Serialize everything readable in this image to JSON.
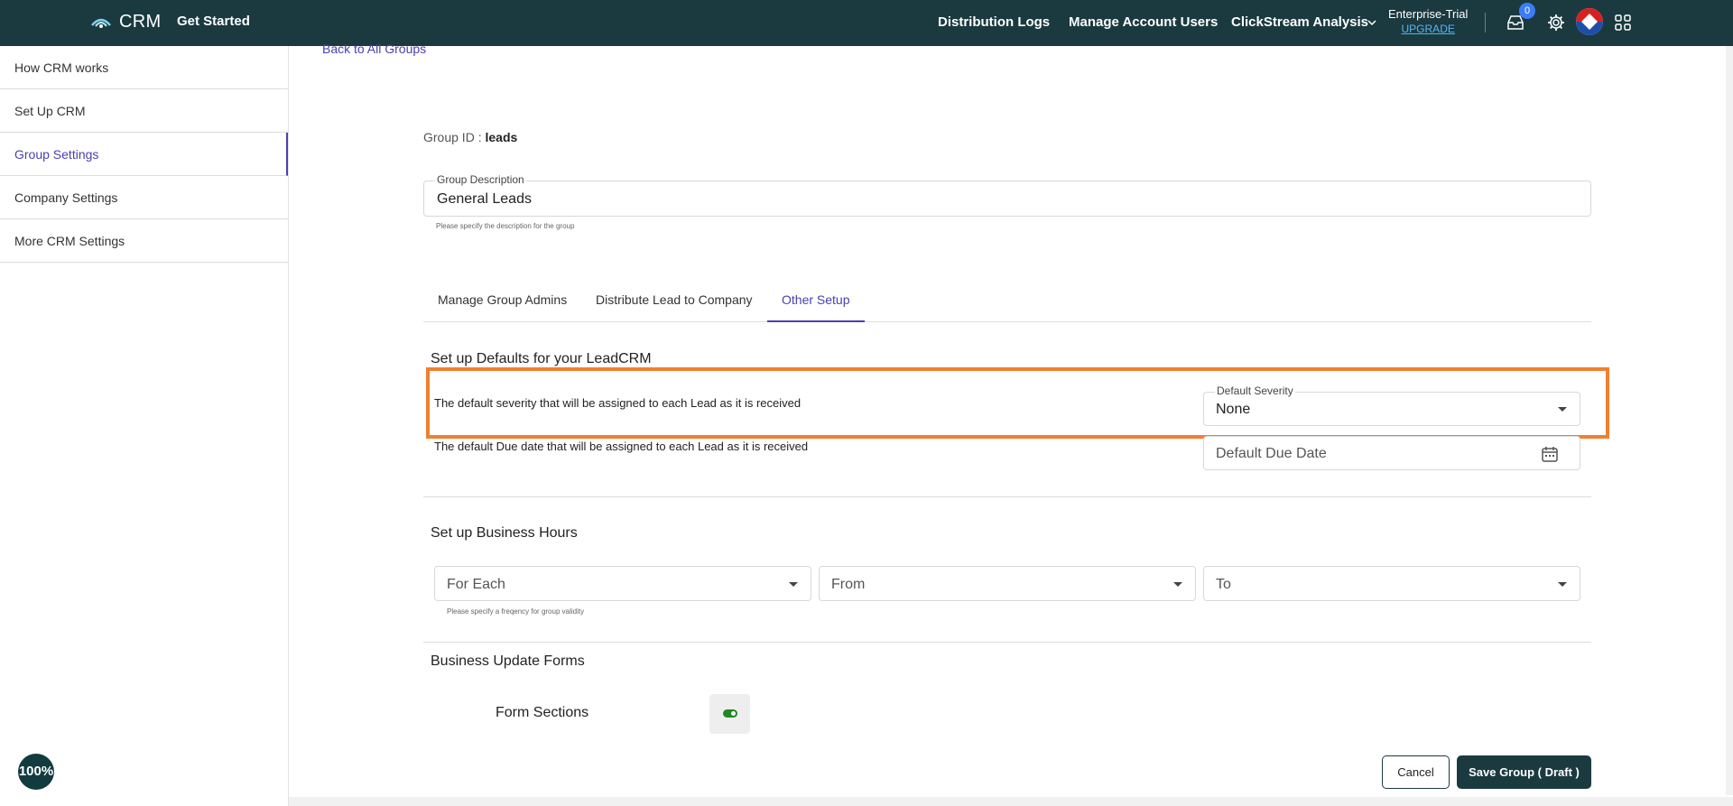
{
  "header": {
    "app_name": "CRM",
    "get_started": "Get Started",
    "nav": [
      "Distribution Logs",
      "Manage Account Users",
      "ClickStream Analysis"
    ],
    "plan_name": "Enterprise-Trial",
    "upgrade_label": "UPGRADE",
    "notification_count": "0",
    "colors": {
      "bar": "#1a3a40",
      "accent": "#4a3fb0",
      "badge": "#3c7df5"
    }
  },
  "sidebar": {
    "items": [
      {
        "label": "How CRM works"
      },
      {
        "label": "Set Up CRM"
      },
      {
        "label": "Group Settings"
      },
      {
        "label": "Company Settings"
      },
      {
        "label": "More CRM Settings"
      }
    ],
    "zoom": "100%"
  },
  "main": {
    "back_link": "Back to All Groups",
    "group_id_label": "Group ID :",
    "group_id_value": "leads",
    "group_description": {
      "label": "Group Description",
      "value": "General Leads",
      "helper": "Please specify the description for the group"
    },
    "tabs": [
      {
        "label": "Manage Group Admins"
      },
      {
        "label": "Distribute Lead to Company"
      },
      {
        "label": "Other Setup"
      }
    ],
    "defaults": {
      "title": "Set up Defaults for your LeadCRM",
      "severity_desc": "The default severity that will be assigned to each Lead as it is received",
      "severity_label": "Default Severity",
      "severity_value": "None",
      "due_desc": "The default Due date that will be assigned to each Lead as it is received",
      "due_placeholder": "Default Due Date"
    },
    "business_hours": {
      "title": "Set up Business Hours",
      "for_each": "For Each",
      "from": "From",
      "to": "To",
      "helper": "Please specify a freqency for group validity"
    },
    "forms": {
      "title": "Business Update Forms",
      "form_sections_label": "Form Sections",
      "form_sections_enabled": true
    },
    "actions": {
      "cancel": "Cancel",
      "save": "Save Group ( Draft )"
    }
  }
}
